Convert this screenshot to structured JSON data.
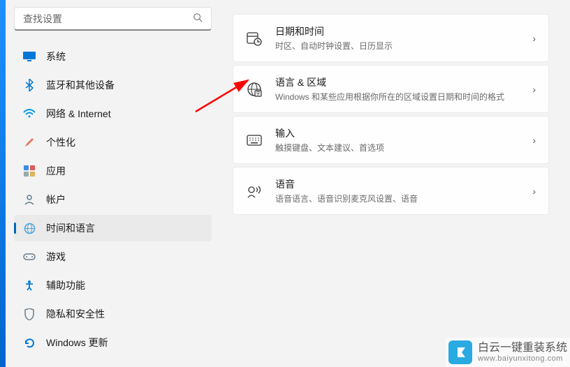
{
  "search": {
    "placeholder": "查找设置"
  },
  "sidebar": {
    "items": [
      {
        "label": "系统"
      },
      {
        "label": "蓝牙和其他设备"
      },
      {
        "label": "网络 & Internet"
      },
      {
        "label": "个性化"
      },
      {
        "label": "应用"
      },
      {
        "label": "帐户"
      },
      {
        "label": "时间和语言"
      },
      {
        "label": "游戏"
      },
      {
        "label": "辅助功能"
      },
      {
        "label": "隐私和安全性"
      },
      {
        "label": "Windows 更新"
      }
    ]
  },
  "main": {
    "cards": [
      {
        "title": "日期和时间",
        "desc": "时区、自动时钟设置、日历显示"
      },
      {
        "title": "语言 & 区域",
        "desc": "Windows 和某些应用根据你所在的区域设置日期和时间的格式"
      },
      {
        "title": "输入",
        "desc": "触摸键盘、文本建议、首选项"
      },
      {
        "title": "语音",
        "desc": "语音语言、语音识别麦克风设置、语音"
      }
    ]
  },
  "watermark": {
    "main": "白云一键重装系统",
    "sub": "www.baiyunxitong.com"
  }
}
